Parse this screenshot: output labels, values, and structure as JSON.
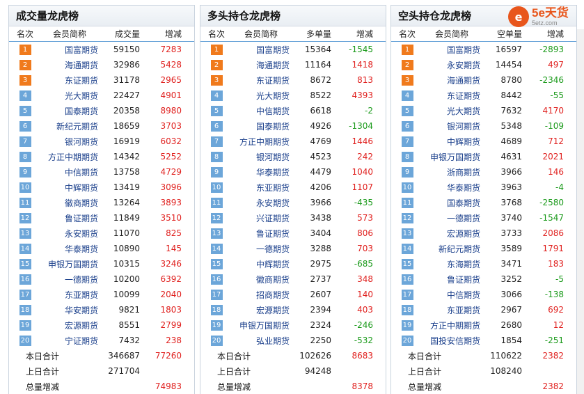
{
  "columns": {
    "rank": "名次",
    "member": "会员简称",
    "change": "增减"
  },
  "summary_labels": {
    "today": "本日合计",
    "yesterday": "上日合计",
    "total_change": "总量增减"
  },
  "logo": {
    "main": "5e天货",
    "sub": "5etz.com",
    "circle": "e"
  },
  "colors": {
    "top3_badge": "#f07a1c",
    "rank_badge": "#6ca6d9",
    "positive": "#e0201e",
    "negative": "#1a9a1a",
    "member_link": "#1a3f8b"
  },
  "panels": [
    {
      "title": "成交量龙虎榜",
      "value_header": "成交量",
      "rows": [
        {
          "rank": "1",
          "name": "国富期货",
          "value": "59150",
          "change": "7283"
        },
        {
          "rank": "2",
          "name": "海通期货",
          "value": "32986",
          "change": "5428"
        },
        {
          "rank": "3",
          "name": "东证期货",
          "value": "31178",
          "change": "2965"
        },
        {
          "rank": "4",
          "name": "光大期货",
          "value": "22427",
          "change": "4901"
        },
        {
          "rank": "5",
          "name": "国泰期货",
          "value": "20358",
          "change": "8980"
        },
        {
          "rank": "6",
          "name": "新纪元期货",
          "value": "18659",
          "change": "3703"
        },
        {
          "rank": "7",
          "name": "银河期货",
          "value": "16919",
          "change": "6032"
        },
        {
          "rank": "8",
          "name": "方正中期期货",
          "value": "14342",
          "change": "5252"
        },
        {
          "rank": "9",
          "name": "中信期货",
          "value": "13758",
          "change": "4729"
        },
        {
          "rank": "10",
          "name": "中辉期货",
          "value": "13419",
          "change": "3096"
        },
        {
          "rank": "11",
          "name": "徽商期货",
          "value": "13264",
          "change": "3893"
        },
        {
          "rank": "12",
          "name": "鲁证期货",
          "value": "11849",
          "change": "3510"
        },
        {
          "rank": "13",
          "name": "永安期货",
          "value": "11070",
          "change": "825"
        },
        {
          "rank": "14",
          "name": "华泰期货",
          "value": "10890",
          "change": "145"
        },
        {
          "rank": "15",
          "name": "申银万国期货",
          "value": "10315",
          "change": "3246"
        },
        {
          "rank": "16",
          "name": "一德期货",
          "value": "10200",
          "change": "6392"
        },
        {
          "rank": "17",
          "name": "东亚期货",
          "value": "10099",
          "change": "2040"
        },
        {
          "rank": "18",
          "name": "华安期货",
          "value": "9821",
          "change": "1803"
        },
        {
          "rank": "19",
          "name": "宏源期货",
          "value": "8551",
          "change": "2799"
        },
        {
          "rank": "20",
          "name": "宁证期货",
          "value": "7432",
          "change": "238"
        }
      ],
      "today": {
        "value": "346687",
        "change": "77260"
      },
      "yesterday": {
        "value": "271704"
      },
      "total_change": {
        "change": "74983"
      }
    },
    {
      "title": "多头持仓龙虎榜",
      "value_header": "多单量",
      "rows": [
        {
          "rank": "1",
          "name": "国富期货",
          "value": "15364",
          "change": "-1545"
        },
        {
          "rank": "2",
          "name": "海通期货",
          "value": "11164",
          "change": "1418"
        },
        {
          "rank": "3",
          "name": "东证期货",
          "value": "8672",
          "change": "813"
        },
        {
          "rank": "4",
          "name": "光大期货",
          "value": "8522",
          "change": "4393"
        },
        {
          "rank": "5",
          "name": "中信期货",
          "value": "6618",
          "change": "-2"
        },
        {
          "rank": "6",
          "name": "国泰期货",
          "value": "4926",
          "change": "-1304"
        },
        {
          "rank": "7",
          "name": "方正中期期货",
          "value": "4769",
          "change": "1446"
        },
        {
          "rank": "8",
          "name": "银河期货",
          "value": "4523",
          "change": "242"
        },
        {
          "rank": "9",
          "name": "华泰期货",
          "value": "4479",
          "change": "1040"
        },
        {
          "rank": "10",
          "name": "东亚期货",
          "value": "4206",
          "change": "1107"
        },
        {
          "rank": "11",
          "name": "永安期货",
          "value": "3966",
          "change": "-435"
        },
        {
          "rank": "12",
          "name": "兴证期货",
          "value": "3438",
          "change": "573"
        },
        {
          "rank": "13",
          "name": "鲁证期货",
          "value": "3404",
          "change": "806"
        },
        {
          "rank": "14",
          "name": "一德期货",
          "value": "3288",
          "change": "703"
        },
        {
          "rank": "15",
          "name": "中辉期货",
          "value": "2975",
          "change": "-685"
        },
        {
          "rank": "16",
          "name": "徽商期货",
          "value": "2737",
          "change": "348"
        },
        {
          "rank": "17",
          "name": "招商期货",
          "value": "2607",
          "change": "140"
        },
        {
          "rank": "18",
          "name": "宏源期货",
          "value": "2394",
          "change": "403"
        },
        {
          "rank": "19",
          "name": "申银万国期货",
          "value": "2324",
          "change": "-246"
        },
        {
          "rank": "20",
          "name": "弘业期货",
          "value": "2250",
          "change": "-532"
        }
      ],
      "today": {
        "value": "102626",
        "change": "8683"
      },
      "yesterday": {
        "value": "94248"
      },
      "total_change": {
        "change": "8378"
      }
    },
    {
      "title": "空头持仓龙虎榜",
      "value_header": "空单量",
      "rows": [
        {
          "rank": "1",
          "name": "国富期货",
          "value": "16597",
          "change": "-2893"
        },
        {
          "rank": "2",
          "name": "永安期货",
          "value": "14454",
          "change": "497"
        },
        {
          "rank": "3",
          "name": "海通期货",
          "value": "8780",
          "change": "-2346"
        },
        {
          "rank": "4",
          "name": "东证期货",
          "value": "8442",
          "change": "-55"
        },
        {
          "rank": "5",
          "name": "光大期货",
          "value": "7632",
          "change": "4170"
        },
        {
          "rank": "6",
          "name": "银河期货",
          "value": "5348",
          "change": "-109"
        },
        {
          "rank": "7",
          "name": "中辉期货",
          "value": "4689",
          "change": "712"
        },
        {
          "rank": "8",
          "name": "申银万国期货",
          "value": "4631",
          "change": "2021"
        },
        {
          "rank": "9",
          "name": "浙商期货",
          "value": "3966",
          "change": "146"
        },
        {
          "rank": "10",
          "name": "华泰期货",
          "value": "3963",
          "change": "-4"
        },
        {
          "rank": "11",
          "name": "国泰期货",
          "value": "3768",
          "change": "-2580"
        },
        {
          "rank": "12",
          "name": "一德期货",
          "value": "3740",
          "change": "-1547"
        },
        {
          "rank": "13",
          "name": "宏源期货",
          "value": "3733",
          "change": "2086"
        },
        {
          "rank": "14",
          "name": "新纪元期货",
          "value": "3589",
          "change": "1791"
        },
        {
          "rank": "15",
          "name": "东海期货",
          "value": "3471",
          "change": "183"
        },
        {
          "rank": "16",
          "name": "鲁证期货",
          "value": "3252",
          "change": "-5"
        },
        {
          "rank": "17",
          "name": "中信期货",
          "value": "3066",
          "change": "-138"
        },
        {
          "rank": "18",
          "name": "东亚期货",
          "value": "2967",
          "change": "692"
        },
        {
          "rank": "19",
          "name": "方正中期期货",
          "value": "2680",
          "change": "12"
        },
        {
          "rank": "20",
          "name": "国投安信期货",
          "value": "1854",
          "change": "-251"
        }
      ],
      "today": {
        "value": "110622",
        "change": "2382"
      },
      "yesterday": {
        "value": "108240"
      },
      "total_change": {
        "change": "2382"
      }
    }
  ]
}
